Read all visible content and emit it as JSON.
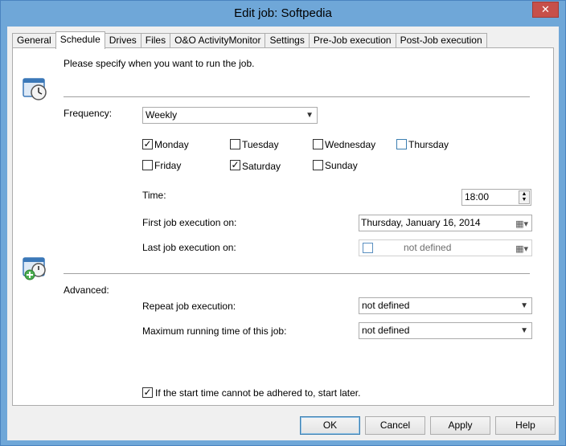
{
  "window": {
    "title": "Edit job: Softpedia",
    "close_glyph": "✕"
  },
  "tabs": [
    {
      "label": "General"
    },
    {
      "label": "Schedule"
    },
    {
      "label": "Drives"
    },
    {
      "label": "Files"
    },
    {
      "label": "O&O ActivityMonitor"
    },
    {
      "label": "Settings"
    },
    {
      "label": "Pre-Job execution"
    },
    {
      "label": "Post-Job execution"
    }
  ],
  "schedule": {
    "intro": "Please specify when you want to run the job.",
    "frequency_label": "Frequency:",
    "frequency_value": "Weekly",
    "days": [
      {
        "label": "Monday",
        "checked": true
      },
      {
        "label": "Tuesday",
        "checked": false
      },
      {
        "label": "Wednesday",
        "checked": false
      },
      {
        "label": "Thursday",
        "checked": false
      },
      {
        "label": "Friday",
        "checked": false
      },
      {
        "label": "Saturday",
        "checked": true
      },
      {
        "label": "Sunday",
        "checked": false
      }
    ],
    "time_label": "Time:",
    "time_value": "18:00",
    "first_label": "First job execution on:",
    "first_value": "Thursday, January 16, 2014",
    "last_label": "Last job execution on:",
    "last_value": "not defined"
  },
  "advanced": {
    "label": "Advanced:",
    "repeat_label": "Repeat job execution:",
    "repeat_value": "not defined",
    "maxrun_label": "Maximum running time of this job:",
    "maxrun_value": "not defined",
    "start_later_label": "If the start time cannot be adhered to, start later.",
    "start_later_checked": true
  },
  "buttons": {
    "ok": "OK",
    "cancel": "Cancel",
    "apply": "Apply",
    "help": "Help"
  },
  "glyphs": {
    "check": "✓",
    "dropdown": "▼",
    "spin_up": "▲",
    "spin_down": "▼",
    "calendar": "▦▾"
  },
  "colors": {
    "titlebar": "#6fa7d8",
    "close": "#c7504a",
    "accent_blue": "#3c7fb1"
  }
}
